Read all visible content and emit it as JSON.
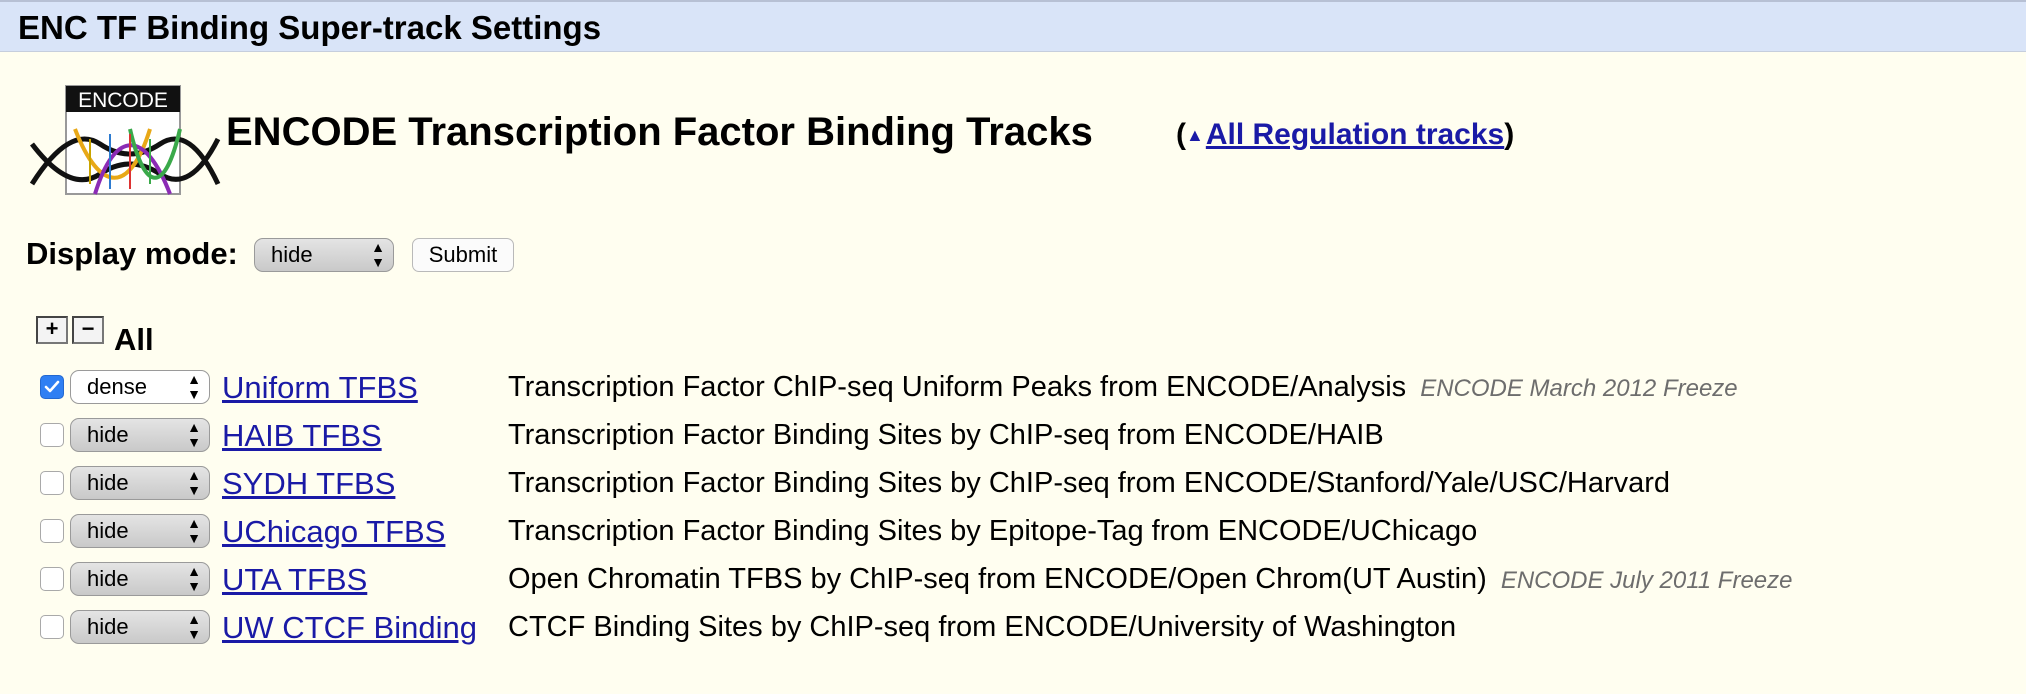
{
  "page_title": "ENC TF Binding Super-track Settings",
  "logo": {
    "text": "ENCODE"
  },
  "heading": {
    "title": "ENCODE Transcription Factor Binding Tracks",
    "link_open": "(",
    "link_arrow": "▲",
    "link_text": "All Regulation tracks",
    "link_close": ")"
  },
  "display_mode": {
    "label": "Display mode:",
    "selected": "hide",
    "submit_label": "Submit"
  },
  "all_controls": {
    "plus": "+",
    "minus": "−",
    "label": "All"
  },
  "tracks": [
    {
      "checked": true,
      "mode": "dense",
      "name": "Uniform TFBS",
      "description": "Transcription Factor ChIP-seq Uniform Peaks from ENCODE/Analysis",
      "freeze": "ENCODE March 2012 Freeze"
    },
    {
      "checked": false,
      "mode": "hide",
      "name": "HAIB TFBS",
      "description": "Transcription Factor Binding Sites by ChIP-seq from ENCODE/HAIB",
      "freeze": ""
    },
    {
      "checked": false,
      "mode": "hide",
      "name": "SYDH TFBS",
      "description": "Transcription Factor Binding Sites by ChIP-seq from ENCODE/Stanford/Yale/USC/Harvard",
      "freeze": ""
    },
    {
      "checked": false,
      "mode": "hide",
      "name": "UChicago TFBS",
      "description": "Transcription Factor Binding Sites by Epitope-Tag from ENCODE/UChicago",
      "freeze": ""
    },
    {
      "checked": false,
      "mode": "hide",
      "name": "UTA TFBS",
      "description": "Open Chromatin TFBS by ChIP-seq from ENCODE/Open Chrom(UT Austin)",
      "freeze": "ENCODE July 2011 Freeze"
    },
    {
      "checked": false,
      "mode": "hide",
      "name": "UW CTCF Binding",
      "description": "CTCF Binding Sites by ChIP-seq from ENCODE/University of Washington",
      "freeze": ""
    }
  ],
  "colors": {
    "page_background": "#fffef0",
    "title_bar": "#d9e4f8",
    "link": "#1a1aa6",
    "freeze_text": "#6d6d6d",
    "checkbox_checked": "#2f7ff3"
  }
}
